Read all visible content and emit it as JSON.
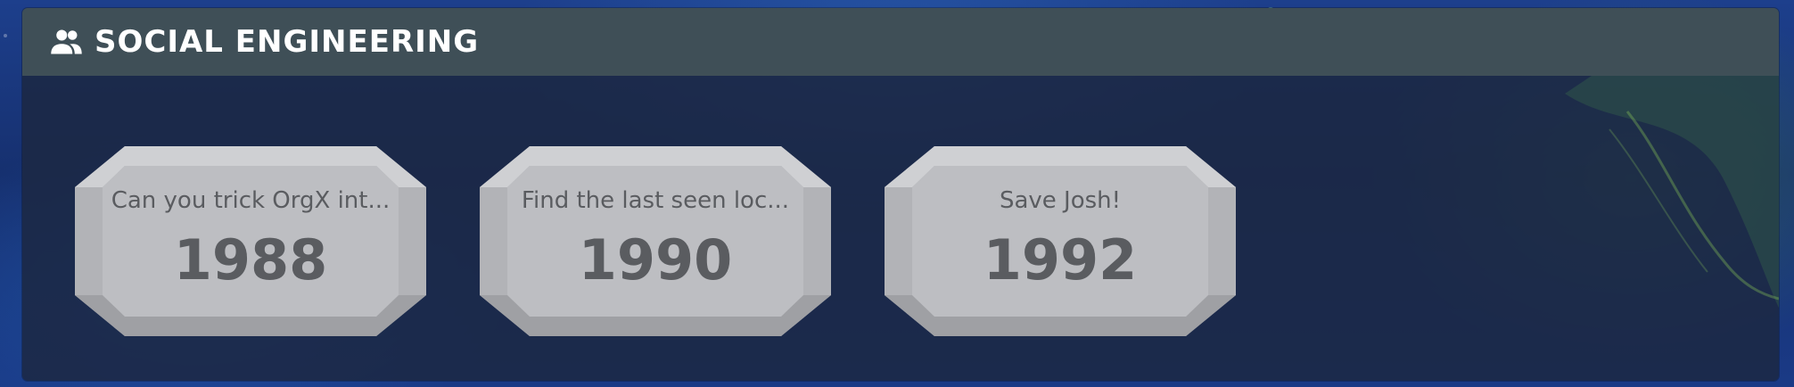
{
  "category": {
    "title": "SOCIAL ENGINEERING",
    "icon": "group-icon"
  },
  "challenges": [
    {
      "title": "Can you trick OrgX int...",
      "points": "1988"
    },
    {
      "title": "Find the last seen loc...",
      "points": "1990"
    },
    {
      "title": "Save Josh!",
      "points": "1992"
    }
  ],
  "colors": {
    "header_bg": "#3f4f57",
    "panel_bg": "#1c2842",
    "card_face": "#bdbec2",
    "card_text": "#5a5c60"
  }
}
